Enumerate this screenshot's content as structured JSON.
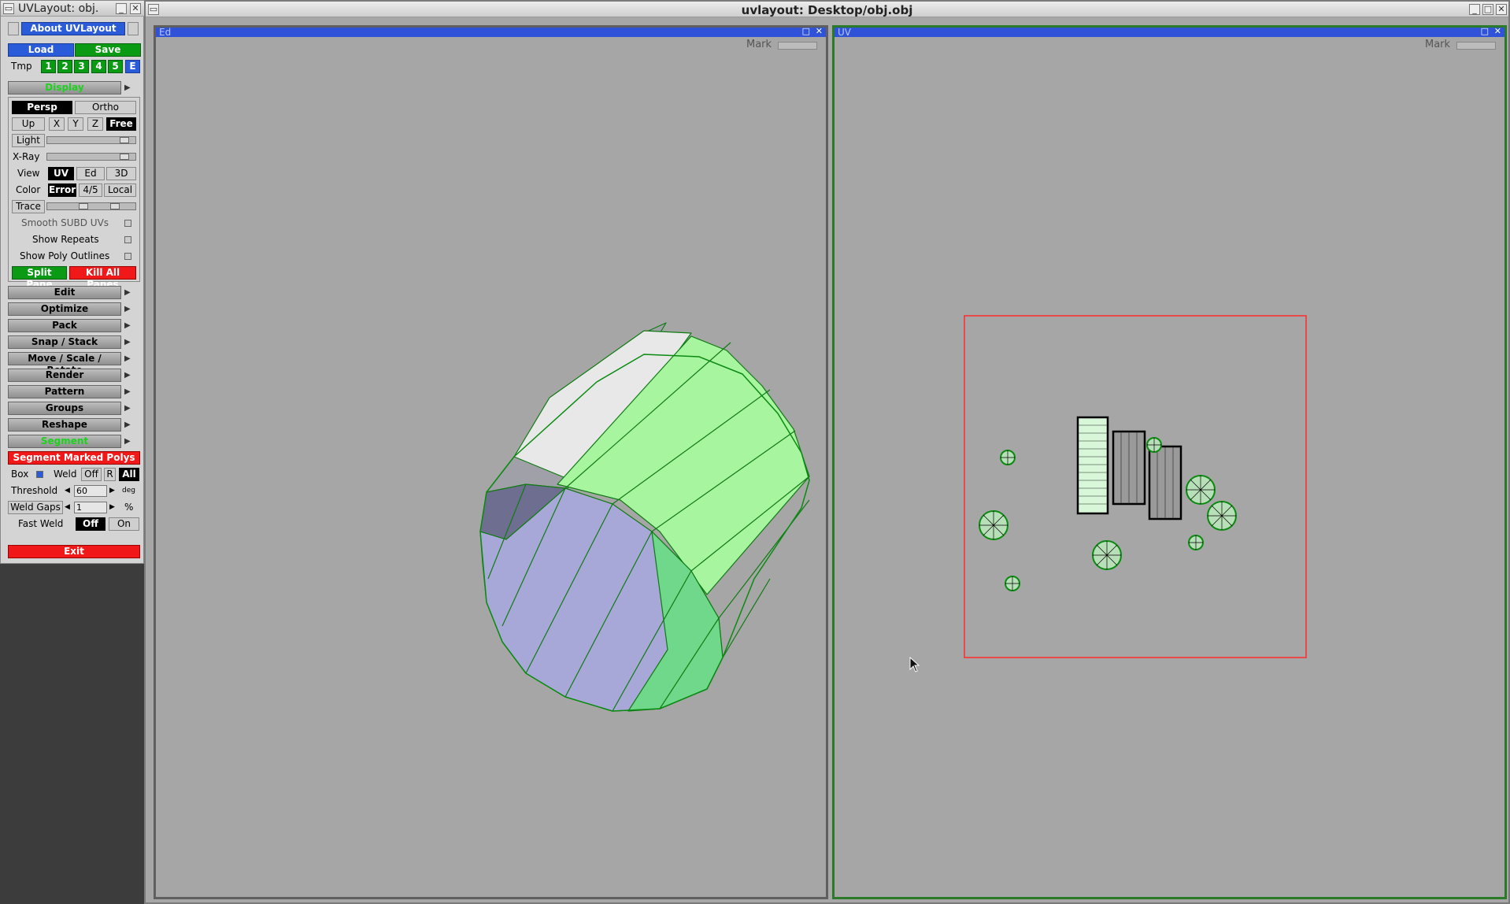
{
  "tool_window": {
    "title": "UVLayout: obj.",
    "about": "About UVLayout",
    "load": "Load",
    "save": "Save",
    "tmp_label": "Tmp",
    "tmp_slots": [
      "1",
      "2",
      "3",
      "4",
      "5",
      "E"
    ],
    "display_section": "Display",
    "persp": "Persp",
    "ortho": "Ortho",
    "up_label": "Up",
    "axes": [
      "X",
      "Y",
      "Z",
      "Free"
    ],
    "light_label": "Light",
    "xray_label": "X-Ray",
    "view_label": "View",
    "view_modes": [
      "UV",
      "Ed",
      "3D"
    ],
    "color_label": "Color",
    "color_modes": [
      "Error",
      "4/5",
      "Local"
    ],
    "trace_label": "Trace",
    "options": [
      "Smooth SUBD UVs",
      "Show Repeats",
      "Show Poly Outlines"
    ],
    "split_pane": "Split Pane",
    "kill_all_panes": "Kill All Panes",
    "sections": [
      "Edit",
      "Optimize",
      "Pack",
      "Snap / Stack",
      "Move / Scale / Rotate",
      "Render",
      "Pattern",
      "Groups",
      "Reshape",
      "Segment"
    ],
    "segment_marked": "Segment Marked Polys",
    "box_label": "Box",
    "weld_label": "Weld",
    "weld_off": "Off",
    "weld_r": "R",
    "weld_all": "All",
    "threshold_label": "Threshold",
    "threshold_value": "60",
    "threshold_unit": "deg",
    "weld_gaps_label": "Weld Gaps",
    "weld_gaps_value": "1",
    "weld_gaps_unit": "%",
    "fast_weld_label": "Fast Weld",
    "fast_weld_off": "Off",
    "fast_weld_on": "On",
    "exit": "Exit"
  },
  "main_window": {
    "title": "uvlayout: Desktop/obj.obj",
    "ed_pane": {
      "label": "Ed",
      "mark": "Mark"
    },
    "uv_pane": {
      "label": "UV",
      "mark": "Mark"
    }
  },
  "colors": {
    "accent_blue": "#2a5bd8",
    "green": "#0a9a14",
    "red": "#f01818",
    "mesh_green": "#a8f5a0",
    "mesh_blue": "#a8a8d8"
  }
}
